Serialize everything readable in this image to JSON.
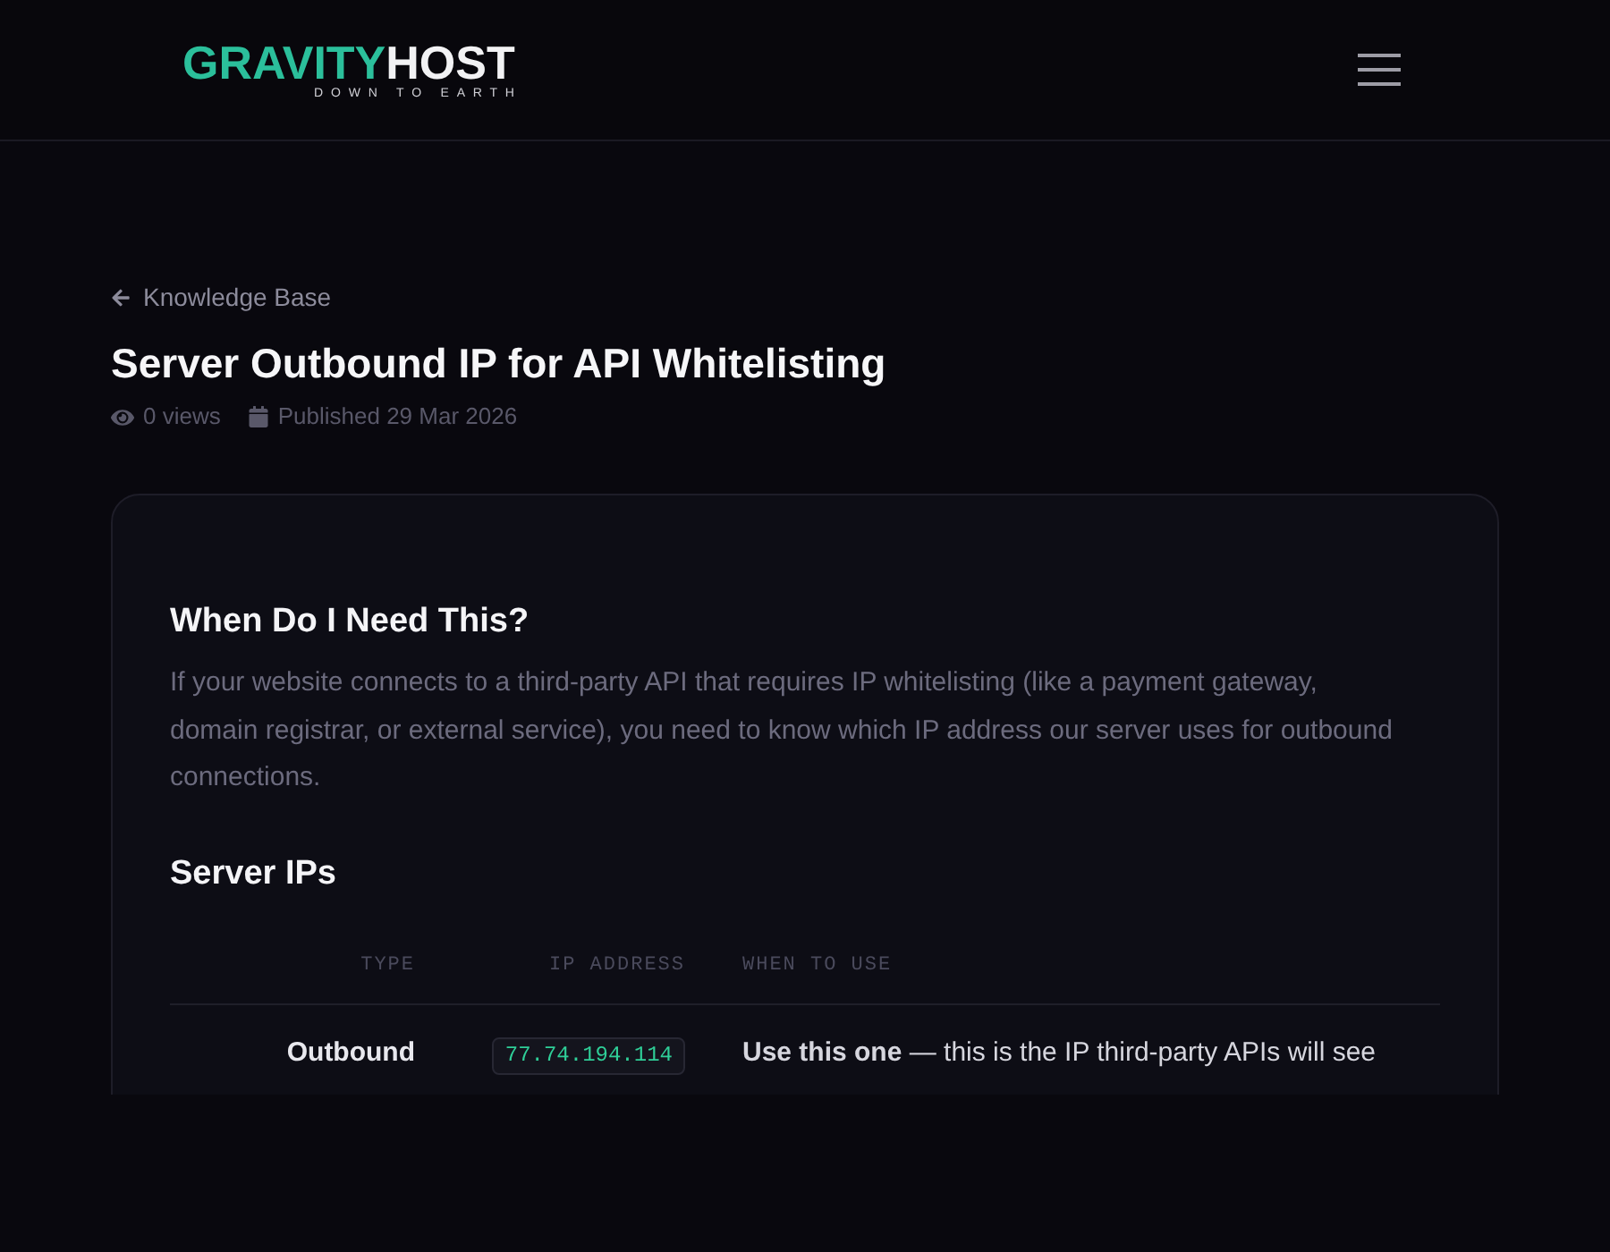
{
  "header": {
    "logo": {
      "primary": "GRAVITY",
      "secondary": "HOST",
      "tagline": "DOWN TO EARTH"
    }
  },
  "breadcrumb": {
    "label": "Knowledge Base"
  },
  "article": {
    "title": "Server Outbound IP for API Whitelisting",
    "views": "0 views",
    "published": "Published 29 Mar 2026"
  },
  "sections": [
    {
      "kind": "text",
      "heading": "When Do I Need This?",
      "paragraph": "If your website connects to a third-party API that requires IP whitelisting (like a payment gateway, domain registrar, or external service), you need to know which IP address our server uses for outbound connections."
    },
    {
      "kind": "table",
      "heading": "Server IPs",
      "columns": [
        "TYPE",
        "IP ADDRESS",
        "WHEN TO USE"
      ],
      "rows": [
        {
          "type": "Outbound",
          "ip_address": "77.74.194.114",
          "when_to_use": "**Use this one** — this is the IP third-party APIs will see"
        }
      ]
    }
  ]
}
